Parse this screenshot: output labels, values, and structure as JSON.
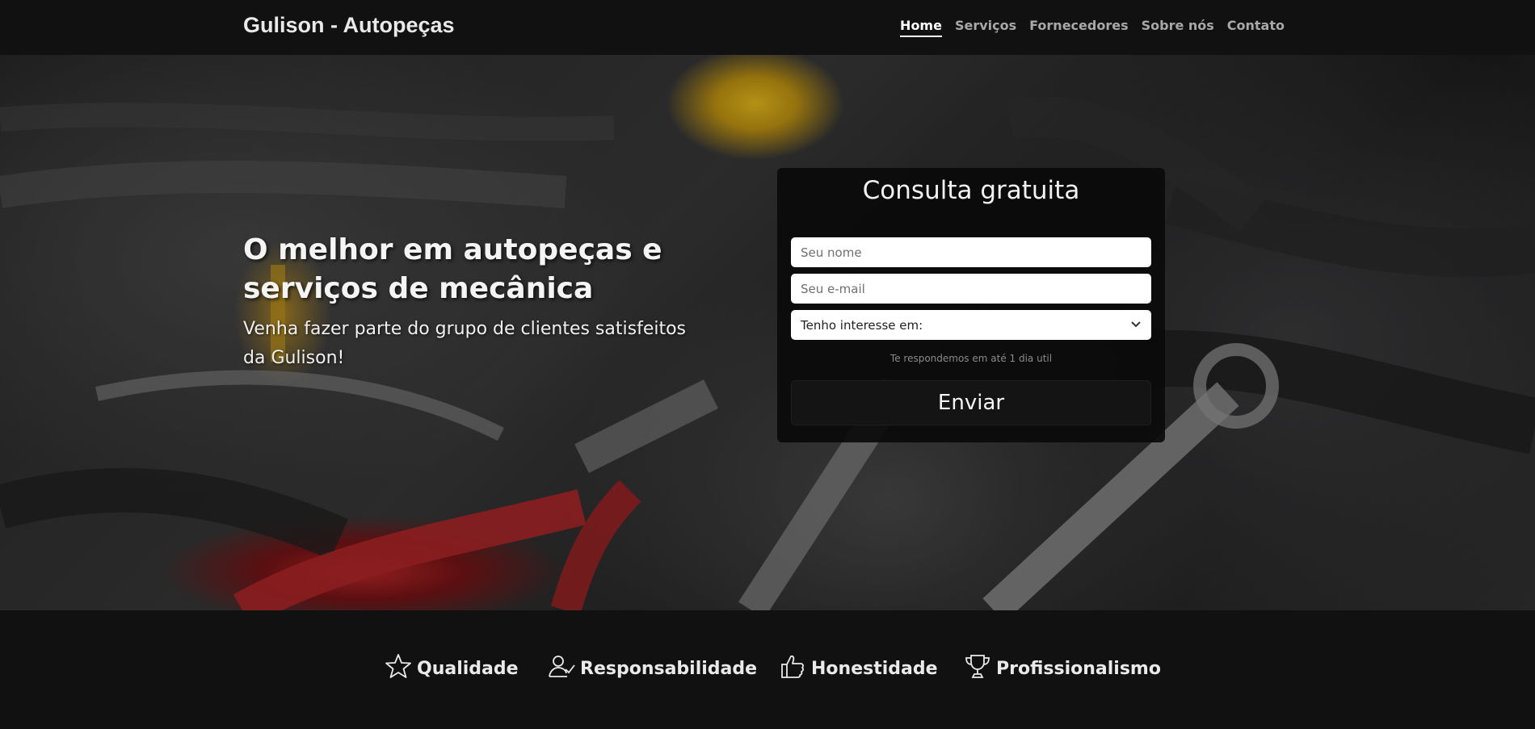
{
  "header": {
    "brand": "Gulison - Autopeças",
    "nav": [
      {
        "label": "Home",
        "active": true
      },
      {
        "label": "Serviços"
      },
      {
        "label": "Fornecedores"
      },
      {
        "label": "Sobre nós"
      },
      {
        "label": "Contato"
      }
    ]
  },
  "hero": {
    "headline": "O melhor em autopeças e serviços de mecânica",
    "subline": "Venha fazer parte do grupo de clientes satisfeitos da Gulison!"
  },
  "form": {
    "title": "Consulta gratuita",
    "name_placeholder": "Seu nome",
    "email_placeholder": "Seu e-mail",
    "interest_selected": "Tenho interesse em:",
    "note": "Te respondemos em até 1 dia util",
    "submit_label": "Enviar"
  },
  "features": [
    {
      "label": "Qualidade",
      "icon": "star-icon"
    },
    {
      "label": "Responsabilidade",
      "icon": "person-check-icon"
    },
    {
      "label": "Honestidade",
      "icon": "thumbs-up-icon"
    },
    {
      "label": "Profissionalismo",
      "icon": "trophy-icon"
    }
  ],
  "colors": {
    "navbar_bg": "#111111",
    "card_bg": "#0a0a0a",
    "accent_blue": "#2a6fd0"
  }
}
